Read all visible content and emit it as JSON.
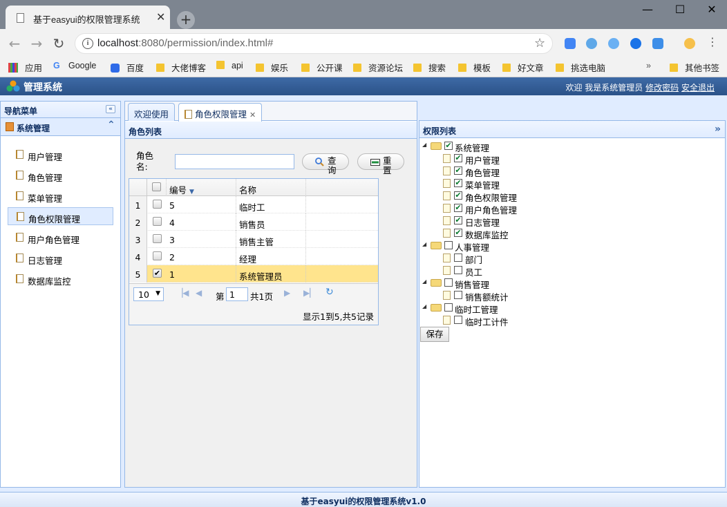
{
  "browser": {
    "tab_title": "基于easyui的权限管理系统",
    "tab_close": "✕",
    "new_tab": "+",
    "url_host": "localhost",
    "url_rest": ":8080/permission/index.html#",
    "window_controls": [
      "—",
      "☐",
      "✕"
    ]
  },
  "bookmarks": {
    "apps": "应用",
    "items": [
      "Google",
      "百度",
      "大佬博客",
      "api",
      "娱乐",
      "公开课",
      "资源论坛",
      "搜索",
      "模板",
      "好文章",
      "挑选电脑"
    ],
    "overflow": "»",
    "other": "其他书签"
  },
  "header": {
    "title": "管理系统",
    "welcome": "欢迎 我是系统管理员",
    "change_password": "修改密码",
    "logout": "安全退出"
  },
  "nav": {
    "title": "导航菜单",
    "collapse": "«",
    "section": "系统管理",
    "section_toggle": "⌃",
    "items": [
      "用户管理",
      "角色管理",
      "菜单管理",
      "角色权限管理",
      "用户角色管理",
      "日志管理",
      "数据库监控"
    ],
    "selected_index": 3
  },
  "center_tabs": [
    {
      "label": "欢迎使用"
    },
    {
      "label": "角色权限管理",
      "close": "✕"
    }
  ],
  "role_panel": {
    "title": "角色列表",
    "search_label": "角色名:",
    "search_value": "",
    "query_btn": "查询",
    "reset_btn": "重置",
    "columns": [
      "编号",
      "名称"
    ],
    "rows": [
      {
        "n": "1",
        "id": "5",
        "name": "临时工",
        "checked": false
      },
      {
        "n": "2",
        "id": "4",
        "name": "销售员",
        "checked": false
      },
      {
        "n": "3",
        "id": "3",
        "name": "销售主管",
        "checked": false
      },
      {
        "n": "4",
        "id": "2",
        "name": "经理",
        "checked": false
      },
      {
        "n": "5",
        "id": "1",
        "name": "系统管理员",
        "checked": true
      }
    ],
    "page_size": "10",
    "page_prefix": "第",
    "page_value": "1",
    "page_total": "共1页",
    "page_info": "显示1到5,共5记录"
  },
  "perm_panel": {
    "title": "权限列表",
    "collapse": "»",
    "tree": [
      {
        "label": "系统管理",
        "checked": true,
        "children": [
          {
            "label": "用户管理",
            "checked": true
          },
          {
            "label": "角色管理",
            "checked": true
          },
          {
            "label": "菜单管理",
            "checked": true
          },
          {
            "label": "角色权限管理",
            "checked": true
          },
          {
            "label": "用户角色管理",
            "checked": true
          },
          {
            "label": "日志管理",
            "checked": true
          },
          {
            "label": "数据库监控",
            "checked": true
          }
        ]
      },
      {
        "label": "人事管理",
        "checked": false,
        "children": [
          {
            "label": "部门",
            "checked": false
          },
          {
            "label": "员工",
            "checked": false
          }
        ]
      },
      {
        "label": "销售管理",
        "checked": false,
        "children": [
          {
            "label": "销售额统计",
            "checked": false
          }
        ]
      },
      {
        "label": "临时工管理",
        "checked": false,
        "children": [
          {
            "label": "临时工计件",
            "checked": false
          }
        ]
      }
    ],
    "save_btn": "保存"
  },
  "footer": "基于easyui的权限管理系统v1.0",
  "colors": {
    "accent": "#95b8e7",
    "header": "#2b5288",
    "selected_row": "#ffe48d"
  }
}
